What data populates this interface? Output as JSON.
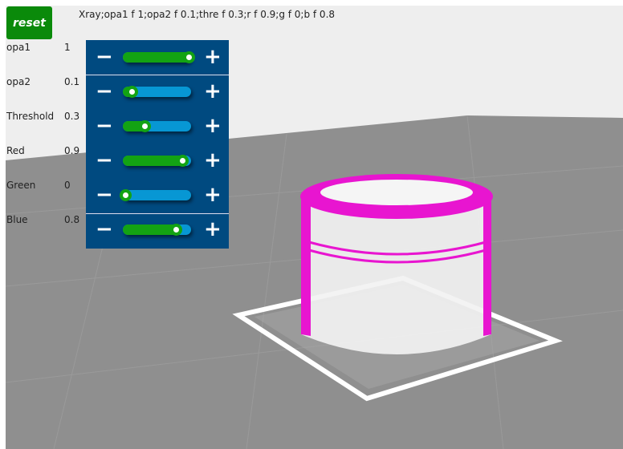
{
  "reset_label": "reset",
  "status": "Xray;opa1 f 1;opa2 f 0.1;thre f 0.3;r f 0.9;g f 0;b f 0.8",
  "controls": [
    {
      "label": "opa1",
      "value": "1",
      "fraction": 1.0
    },
    {
      "label": "opa2",
      "value": "0.1",
      "fraction": 0.1
    },
    {
      "label": "Threshold",
      "value": "0.3",
      "fraction": 0.3
    },
    {
      "label": "Red",
      "value": "0.9",
      "fraction": 0.9
    },
    {
      "label": "Green",
      "value": "0",
      "fraction": 0.0
    },
    {
      "label": "Blue",
      "value": "0.8",
      "fraction": 0.8
    }
  ],
  "minus_icon": "minus-icon",
  "plus_icon": "plus-icon",
  "colors": {
    "object": "#e815d0",
    "floor": "#8f8f8f",
    "sky": "#eeeeee"
  }
}
